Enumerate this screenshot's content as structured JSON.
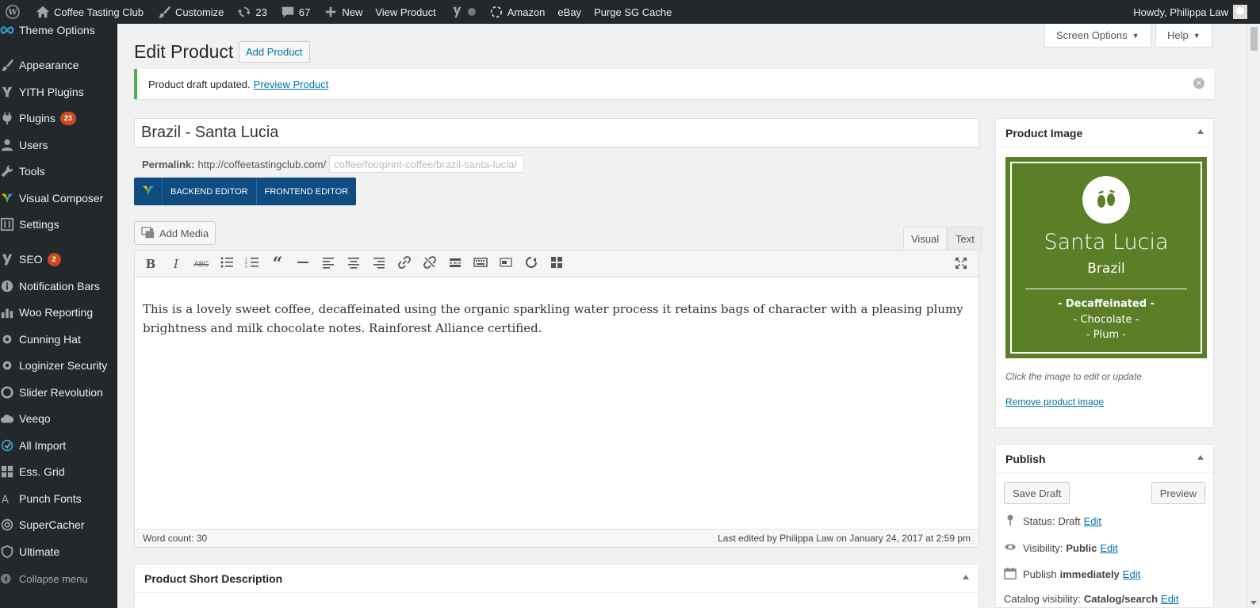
{
  "adminbar": {
    "site": "Coffee Tasting Club",
    "customize": "Customize",
    "updates": "23",
    "comments": "67",
    "new": "New",
    "view_product": "View Product",
    "amazon": "Amazon",
    "ebay": "eBay",
    "purge": "Purge SG Cache",
    "howdy": "Howdy, Philippa Law"
  },
  "sidebar": {
    "items": [
      {
        "label": "Theme Options"
      },
      {
        "label": "Appearance"
      },
      {
        "label": "YITH Plugins"
      },
      {
        "label": "Plugins",
        "badge": "23"
      },
      {
        "label": "Users"
      },
      {
        "label": "Tools"
      },
      {
        "label": "Visual Composer"
      },
      {
        "label": "Settings"
      },
      {
        "label": "SEO",
        "badge": "2"
      },
      {
        "label": "Notification Bars"
      },
      {
        "label": "Woo Reporting"
      },
      {
        "label": "Cunning Hat"
      },
      {
        "label": "Loginizer Security"
      },
      {
        "label": "Slider Revolution"
      },
      {
        "label": "Veeqo"
      },
      {
        "label": "All Import"
      },
      {
        "label": "Ess. Grid"
      },
      {
        "label": "Punch Fonts"
      },
      {
        "label": "SuperCacher"
      },
      {
        "label": "Ultimate"
      }
    ],
    "collapse": "Collapse menu"
  },
  "main": {
    "title": "Edit Product",
    "add_button": "Add Product",
    "screen_options": "Screen Options",
    "help": "Help",
    "notice_text": "Product draft updated.",
    "notice_link": "Preview Product",
    "post_title": "Brazil - Santa Lucia",
    "permalink_label": "Permalink:",
    "permalink_base": "http://coffeetastingclub.com/",
    "permalink_slug": "coffee/footprint-coffee/brazil-santa-lucia/",
    "vc_backend": "BACKEND EDITOR",
    "vc_frontend": "FRONTEND EDITOR",
    "add_media": "Add Media",
    "tab_visual": "Visual",
    "tab_text": "Text",
    "content": "This is a lovely sweet coffee, decaffeinated using the organic sparkling water process it retains bags of character with a pleasing plumy brightness and milk chocolate notes. Rainforest Alliance certified.",
    "word_count": "Word count: 30",
    "last_edited": "Last edited by Philippa Law on January 24, 2017 at 2:59 pm",
    "short_desc_title": "Product Short Description"
  },
  "product_image": {
    "title": "Product Image",
    "img_name": "Santa Lucia",
    "img_origin": "Brazil",
    "img_note1": "- Decaffeinated -",
    "img_note2": "- Chocolate -",
    "img_note3": "- Plum -",
    "hint": "Click the image to edit or update",
    "remove": "Remove product image"
  },
  "publish": {
    "title": "Publish",
    "save_draft": "Save Draft",
    "preview": "Preview",
    "status_label": "Status:",
    "status_value": "Draft",
    "visibility_label": "Visibility:",
    "visibility_value": "Public",
    "publish_label": "Publish",
    "publish_value": "immediately",
    "catalog_label": "Catalog visibility:",
    "catalog_value": "Catalog/search",
    "edit": "Edit"
  },
  "colors": {
    "adminbar_bg": "#23282d",
    "link": "#0073aa",
    "notice_success": "#46b450",
    "badge": "#ca4a1f",
    "vc_blue": "#0f4c81",
    "product_green": "#5a7f27"
  }
}
